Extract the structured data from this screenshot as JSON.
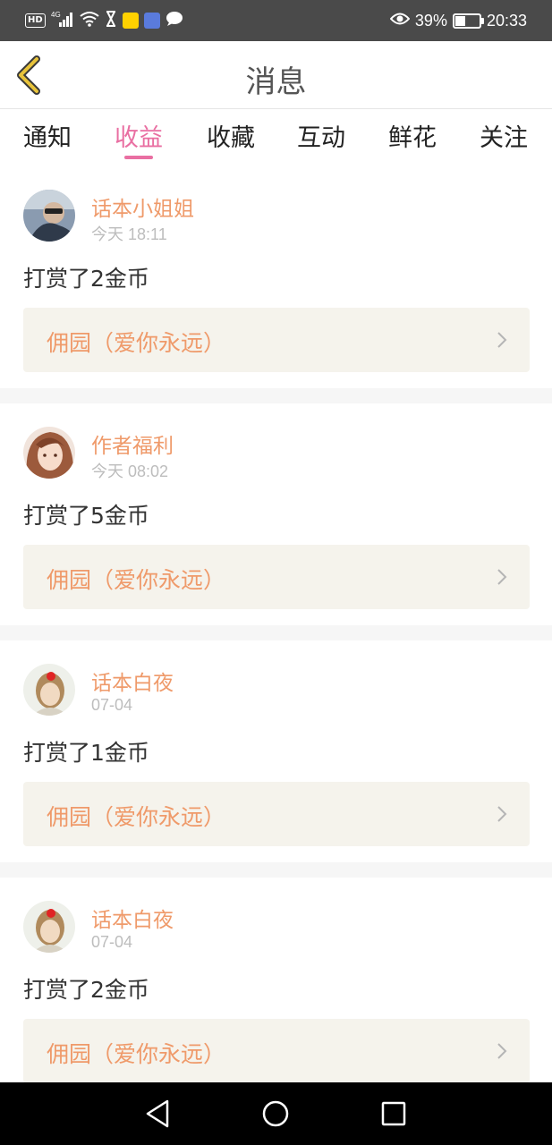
{
  "status_bar": {
    "network_badge": "HD",
    "network_type": "4G",
    "battery_percent": "39%",
    "battery_level": 0.39,
    "time": "20:33",
    "icons": [
      "hd-icon",
      "signal-icon",
      "wifi-icon",
      "hourglass-icon",
      "meituan-app-icon",
      "music-app-icon",
      "chat-bubble-icon",
      "eye-icon",
      "battery-icon"
    ]
  },
  "header": {
    "title": "消息",
    "back_icon": "chevron-left-icon"
  },
  "tabs": [
    {
      "label": "通知"
    },
    {
      "label": "收益"
    },
    {
      "label": "收藏"
    },
    {
      "label": "互动"
    },
    {
      "label": "鲜花"
    },
    {
      "label": "关注"
    }
  ],
  "active_tab": "收益",
  "feed": [
    {
      "username": "话本小姐姐",
      "time": "今天 18:11",
      "message": "打赏了2金币",
      "book_title": "佣园（爱你永远）"
    },
    {
      "username": "作者福利",
      "time": "今天 08:02",
      "message": "打赏了5金币",
      "book_title": "佣园（爱你永远）"
    },
    {
      "username": "话本白夜",
      "time": "07-04",
      "message": "打赏了1金币",
      "book_title": "佣园（爱你永远）"
    },
    {
      "username": "话本白夜",
      "time": "07-04",
      "message": "打赏了2金币",
      "book_title": "佣园（爱你永远）"
    }
  ],
  "colors": {
    "accent_pink": "#e96fa2",
    "username_orange": "#ef9a6a",
    "link_bg": "#f5f3ec",
    "back_icon_yellow": "#e8c33a"
  },
  "nav": {
    "icons": [
      "back-triangle-icon",
      "home-circle-icon",
      "recents-square-icon"
    ]
  }
}
